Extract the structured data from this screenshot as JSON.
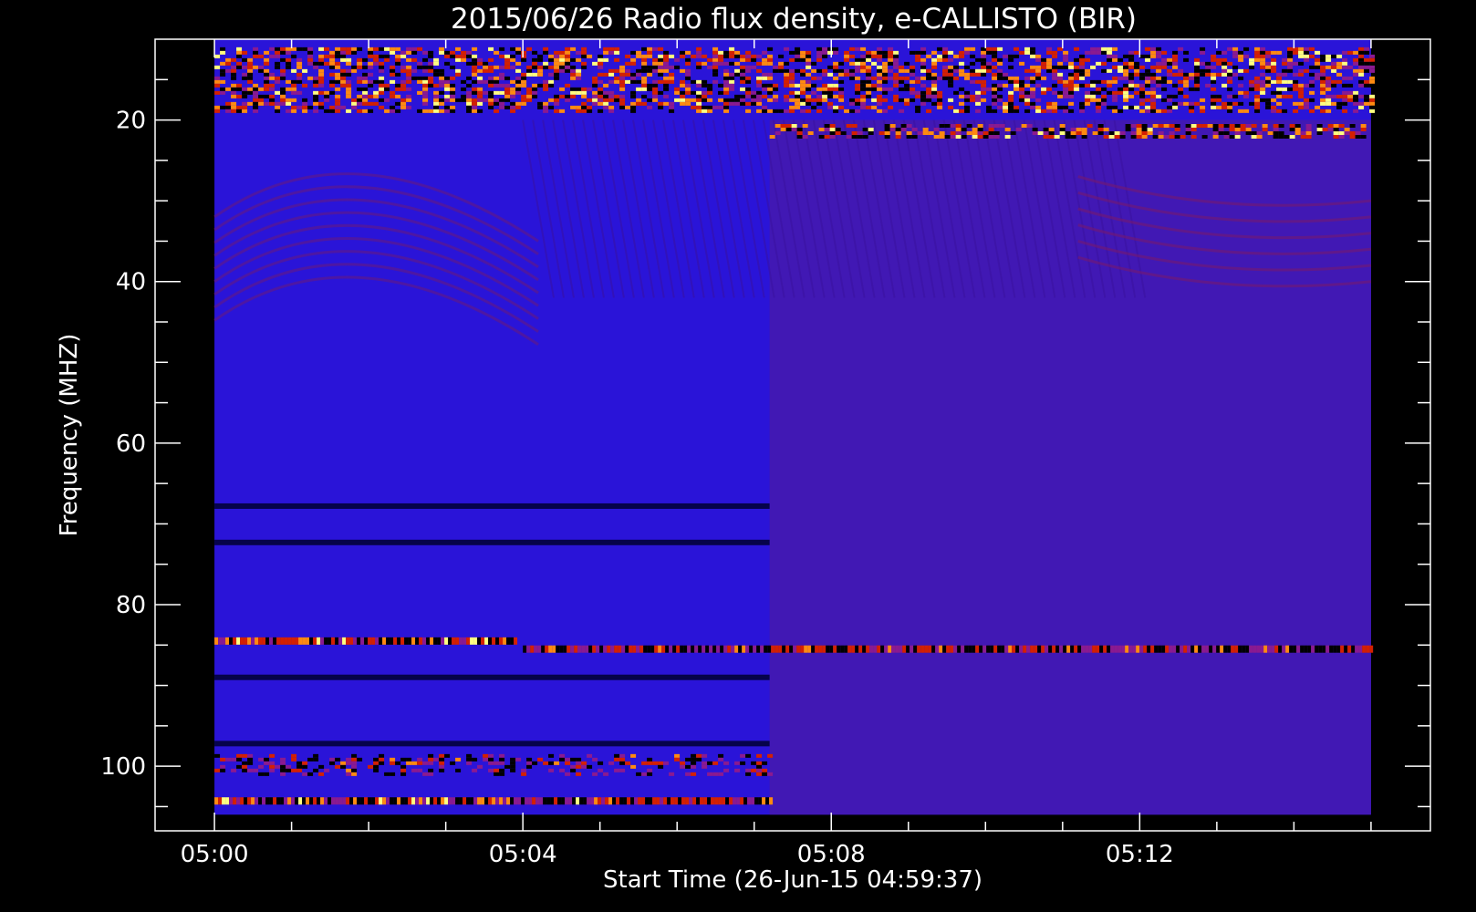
{
  "chart_data": {
    "type": "heatmap",
    "title": "2015/06/26  Radio flux density, e-CALLISTO (BIR)",
    "xlabel": "Start Time (26-Jun-15 04:59:37)",
    "ylabel": "Frequency (MHZ)",
    "x_start": "05:00",
    "x_end": "05:15",
    "x_ticks": [
      "05:00",
      "05:04",
      "05:08",
      "05:12"
    ],
    "x_tick_minutes": [
      0,
      4,
      8,
      12
    ],
    "xlim_minutes": [
      -0.77,
      15.77
    ],
    "y_ticks": [
      20,
      40,
      60,
      80,
      100
    ],
    "ylim": [
      10,
      108
    ],
    "frequency_range": [
      10,
      106
    ],
    "y_inverted": true,
    "colormap": [
      "#000000",
      "#2a14d8",
      "#8a1a90",
      "#d42000",
      "#ff8a10",
      "#ffff80"
    ],
    "background_level": "#2a14d8",
    "regime_change_minute": 7.2,
    "features": [
      {
        "type": "noise_band",
        "f_from": 11,
        "f_to": 19,
        "minute_from": 0,
        "minute_to": 15,
        "intensity": "high"
      },
      {
        "type": "striped_band",
        "f_from": 20.5,
        "f_to": 22,
        "minute_from": 7.2,
        "minute_to": 15,
        "intensity": "high"
      },
      {
        "type": "rfi_line",
        "freq": 84.5,
        "minute_from": 0,
        "minute_to": 3.9,
        "intensity": "high"
      },
      {
        "type": "rfi_line",
        "freq": 85.5,
        "minute_from": 4,
        "minute_to": 15,
        "intensity": "medium"
      },
      {
        "type": "dark_line",
        "freq": 67.8,
        "minute_from": 0,
        "minute_to": 7.2
      },
      {
        "type": "dark_line",
        "freq": 72.3,
        "minute_from": 0,
        "minute_to": 7.2
      },
      {
        "type": "dark_line",
        "freq": 89.0,
        "minute_from": 0,
        "minute_to": 7.2
      },
      {
        "type": "dark_line",
        "freq": 97.2,
        "minute_from": 0,
        "minute_to": 7.2
      },
      {
        "type": "noise_band",
        "f_from": 98.5,
        "f_to": 101,
        "minute_from": 0,
        "minute_to": 7.2,
        "intensity": "medium"
      },
      {
        "type": "rfi_line",
        "freq": 104.3,
        "minute_from": 0,
        "minute_to": 7.2,
        "intensity": "high"
      }
    ]
  }
}
